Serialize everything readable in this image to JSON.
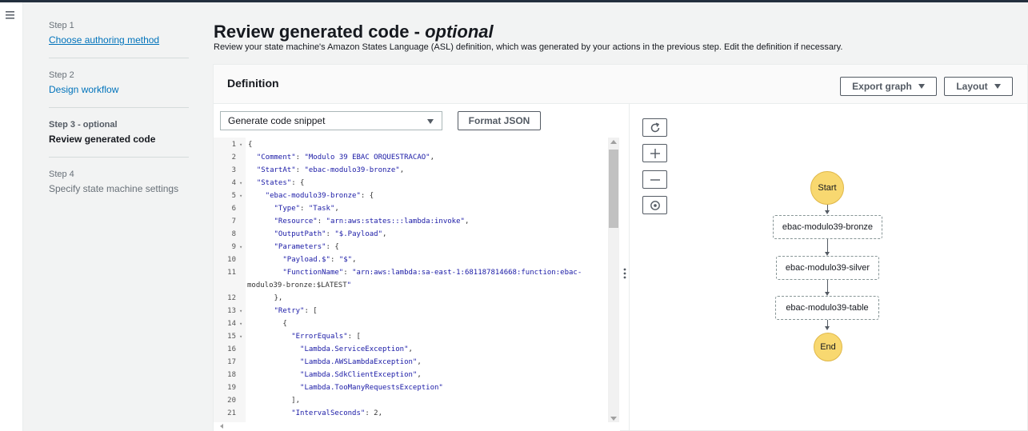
{
  "nav": {
    "menu_icon": "hamburger-menu-icon"
  },
  "steps": [
    {
      "number": "Step 1",
      "label": "Choose authoring method",
      "state": "link"
    },
    {
      "number": "Step 2",
      "label": "Design workflow",
      "state": "blue"
    },
    {
      "number": "Step 3 - optional",
      "label": "Review generated code",
      "state": "current"
    },
    {
      "number": "Step 4",
      "label": "Specify state machine settings",
      "state": "disabled"
    }
  ],
  "page": {
    "title": "Review generated code - ",
    "title_italic": "optional",
    "subtitle": "Review your state machine's Amazon States Language (ASL) definition, which was generated by your actions in the previous step. Edit the definition if necessary."
  },
  "definition": {
    "title": "Definition",
    "export_graph_label": "Export graph",
    "layout_label": "Layout",
    "snippet_select_value": "Generate code snippet",
    "format_json_label": "Format JSON"
  },
  "code_lines": [
    {
      "n": "1",
      "fold": true,
      "text": "{"
    },
    {
      "n": "2",
      "fold": false,
      "text": "  \"Comment\": \"Modulo 39 EBAC ORQUESTRACAO\","
    },
    {
      "n": "3",
      "fold": false,
      "text": "  \"StartAt\": \"ebac-modulo39-bronze\","
    },
    {
      "n": "4",
      "fold": true,
      "text": "  \"States\": {"
    },
    {
      "n": "5",
      "fold": true,
      "text": "    \"ebac-modulo39-bronze\": {"
    },
    {
      "n": "6",
      "fold": false,
      "text": "      \"Type\": \"Task\","
    },
    {
      "n": "7",
      "fold": false,
      "text": "      \"Resource\": \"arn:aws:states:::lambda:invoke\","
    },
    {
      "n": "8",
      "fold": false,
      "text": "      \"OutputPath\": \"$.Payload\","
    },
    {
      "n": "9",
      "fold": true,
      "text": "      \"Parameters\": {"
    },
    {
      "n": "10",
      "fold": false,
      "text": "        \"Payload.$\": \"$\","
    },
    {
      "n": "11",
      "fold": false,
      "text": "        \"FunctionName\": \"arn:aws:lambda:sa-east-1:681187814668:function:ebac-"
    },
    {
      "n": "",
      "fold": false,
      "text": "modulo39-bronze:$LATEST\""
    },
    {
      "n": "12",
      "fold": false,
      "text": "      },"
    },
    {
      "n": "13",
      "fold": true,
      "text": "      \"Retry\": ["
    },
    {
      "n": "14",
      "fold": true,
      "text": "        {"
    },
    {
      "n": "15",
      "fold": true,
      "text": "          \"ErrorEquals\": ["
    },
    {
      "n": "16",
      "fold": false,
      "text": "            \"Lambda.ServiceException\","
    },
    {
      "n": "17",
      "fold": false,
      "text": "            \"Lambda.AWSLambdaException\","
    },
    {
      "n": "18",
      "fold": false,
      "text": "            \"Lambda.SdkClientException\","
    },
    {
      "n": "19",
      "fold": false,
      "text": "            \"Lambda.TooManyRequestsException\""
    },
    {
      "n": "20",
      "fold": false,
      "text": "          ],"
    },
    {
      "n": "21",
      "fold": false,
      "text": "          \"IntervalSeconds\": 2,"
    }
  ],
  "graph": {
    "tools": [
      "refresh-icon",
      "zoom-in-icon",
      "zoom-out-icon",
      "center-icon"
    ],
    "start_label": "Start",
    "end_label": "End",
    "states": [
      "ebac-modulo39-bronze",
      "ebac-modulo39-silver",
      "ebac-modulo39-table"
    ]
  }
}
